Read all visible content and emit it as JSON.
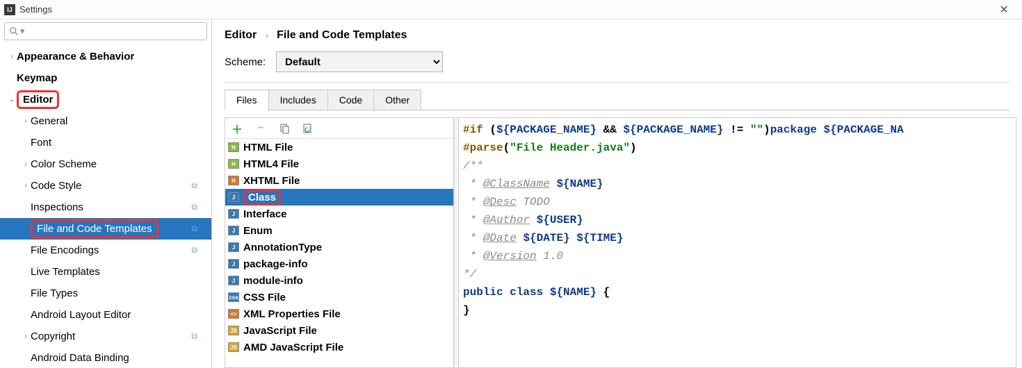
{
  "window": {
    "title": "Settings"
  },
  "search": {
    "placeholder": ""
  },
  "nav": {
    "items": [
      {
        "label": "Appearance & Behavior",
        "bold": true,
        "chev": "›"
      },
      {
        "label": "Keymap",
        "bold": true
      },
      {
        "label": "Editor",
        "bold": true,
        "chev": "⌄",
        "hl": true
      },
      {
        "label": "General",
        "indent": 1,
        "chev": "›"
      },
      {
        "label": "Font",
        "indent": 1
      },
      {
        "label": "Color Scheme",
        "indent": 1,
        "chev": "›"
      },
      {
        "label": "Code Style",
        "indent": 1,
        "chev": "›",
        "copy": true
      },
      {
        "label": "Inspections",
        "indent": 1,
        "copy": true
      },
      {
        "label": "File and Code Templates",
        "indent": 1,
        "copy": true,
        "sel": true,
        "hl": true
      },
      {
        "label": "File Encodings",
        "indent": 1,
        "copy": true
      },
      {
        "label": "Live Templates",
        "indent": 1
      },
      {
        "label": "File Types",
        "indent": 1
      },
      {
        "label": "Android Layout Editor",
        "indent": 1
      },
      {
        "label": "Copyright",
        "indent": 1,
        "chev": "›",
        "copy": true
      },
      {
        "label": "Android Data Binding",
        "indent": 1
      }
    ]
  },
  "breadcrumb": {
    "root": "Editor",
    "leaf": "File and Code Templates"
  },
  "scheme": {
    "label": "Scheme:",
    "value": "Default"
  },
  "tabs": [
    "Files",
    "Includes",
    "Code",
    "Other"
  ],
  "activeTab": 0,
  "templates": [
    {
      "label": "HTML File",
      "badge": "H",
      "bg": "#8fb547"
    },
    {
      "label": "HTML4 File",
      "badge": "H",
      "bg": "#8fb547"
    },
    {
      "label": "XHTML File",
      "badge": "H",
      "bg": "#d07a2c"
    },
    {
      "label": "Class",
      "badge": "J",
      "bg": "#3b78b5",
      "sel": true,
      "hl": true
    },
    {
      "label": "Interface",
      "badge": "J",
      "bg": "#3b78b5"
    },
    {
      "label": "Enum",
      "badge": "J",
      "bg": "#3b78b5"
    },
    {
      "label": "AnnotationType",
      "badge": "J",
      "bg": "#3b78b5"
    },
    {
      "label": "package-info",
      "badge": "J",
      "bg": "#3b78b5"
    },
    {
      "label": "module-info",
      "badge": "J",
      "bg": "#3b78b5"
    },
    {
      "label": "CSS File",
      "badge": "css",
      "bg": "#3a7cc0"
    },
    {
      "label": "XML Properties File",
      "badge": "<>",
      "bg": "#d07a2c"
    },
    {
      "label": "JavaScript File",
      "badge": "JS",
      "bg": "#d9a43a"
    },
    {
      "label": "AMD JavaScript File",
      "badge": "JS",
      "bg": "#d9a43a"
    }
  ],
  "code": {
    "raw": "#if (${PACKAGE_NAME} && ${PACKAGE_NAME} != \"\")package ${PACKAGE_NA\n#parse(\"File Header.java\")\n/**\n * @ClassName ${NAME}\n * @Desc TODO\n * @Author ${USER}\n * @Date ${DATE} ${TIME}\n * @Version 1.0\n*/\npublic class ${NAME} {\n}",
    "t": {
      "if": "#if",
      "parse": "#parse",
      "pkg": "PACKAGE_NAME",
      "ne": " != ",
      "sp": " ",
      "amp": " && ",
      "package": "package",
      "pkgna": "PACKAGE_NA",
      "quote": "\"\"",
      "filehdr": "\"File Header.java\"",
      "star": " * ",
      "cstart": "/**",
      "cend": "*/",
      "cn": "@ClassName",
      "desc": "@Desc",
      "auth": "@Author",
      "date": "@Date",
      "ver": "@Version",
      "todo": " TODO",
      "v10": " 1.0",
      "name": "NAME",
      "user": "USER",
      "dateV": "DATE",
      "timeV": "TIME",
      "public": "public",
      "class": "class",
      "ob": " {",
      "cb": "}",
      "lp": " (",
      "rp": ")",
      "dl": "${",
      "dr": "}"
    }
  }
}
